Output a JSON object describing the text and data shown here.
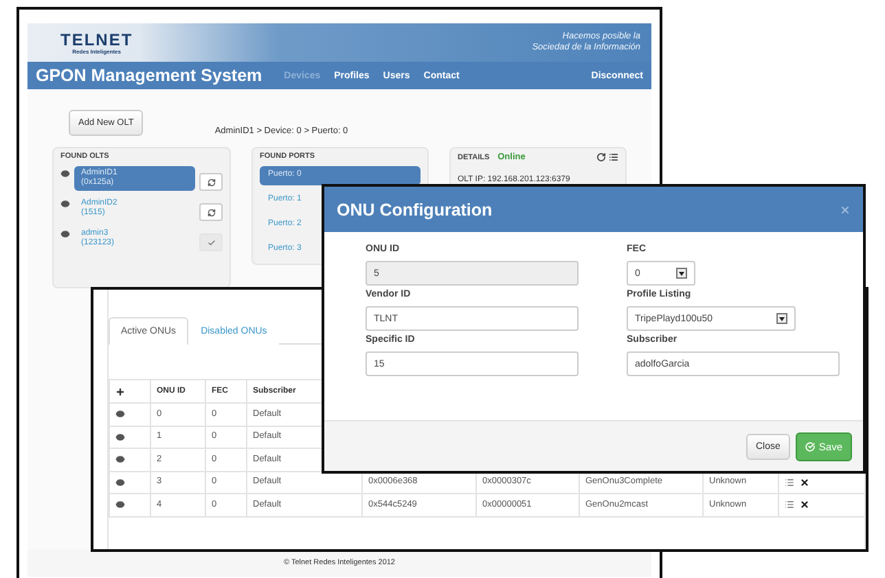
{
  "header": {
    "logo": "TELNET",
    "logo_tagline": "Redes Inteligentes",
    "slogan": [
      "Hacemos posible la",
      "Sociedad de la Información"
    ]
  },
  "navbar": {
    "title": "GPON Management System",
    "items": [
      {
        "label": "Devices",
        "selected": true
      },
      {
        "label": "Profiles",
        "selected": false
      },
      {
        "label": "Users",
        "selected": false
      },
      {
        "label": "Contact",
        "selected": false
      }
    ],
    "disconnect": "Disconnect"
  },
  "add_button": "Add New OLT",
  "breadcrumb": "AdminID1 > Device: 0 > Puerto: 0",
  "found_olts": {
    "title": "FOUND OLTS",
    "items": [
      {
        "name": "AdminID1",
        "id": "(0x125a)",
        "selected": true,
        "kind": "refresh"
      },
      {
        "name": "AdminID2",
        "id": "(1515)",
        "selected": false,
        "kind": "refresh"
      },
      {
        "name": "admin3",
        "id": "(123123)",
        "selected": false,
        "kind": "check"
      }
    ]
  },
  "found_ports": {
    "title": "FOUND PORTS",
    "items": [
      {
        "label": "Puerto: 0",
        "selected": true
      },
      {
        "label": "Puerto: 1",
        "selected": false
      },
      {
        "label": "Puerto: 2",
        "selected": false
      },
      {
        "label": "Puerto: 3",
        "selected": false
      }
    ]
  },
  "details": {
    "title": "DETAILS",
    "status": "Online",
    "olt_ip": "OLT IP: 192.168.201.123:6379"
  },
  "footer": "© Telnet Redes Inteligentes 2012",
  "onu_window": {
    "tabs": [
      {
        "label": "Active ONUs",
        "selected": true
      },
      {
        "label": "Disabled ONUs",
        "selected": false
      }
    ],
    "columns": [
      "ONU ID",
      "FEC",
      "Subscriber"
    ],
    "rows": [
      {
        "cells": [
          "0",
          "0",
          "Default"
        ]
      },
      {
        "cells": [
          "1",
          "0",
          "Default"
        ]
      },
      {
        "cells": [
          "2",
          "0",
          "Default"
        ]
      },
      {
        "cells": [
          "3",
          "0",
          "Default",
          "0x0006e368",
          "0x0000307c",
          "GenOnu3Complete",
          "Unknown"
        ]
      },
      {
        "cells": [
          "4",
          "0",
          "Default",
          "0x544c5249",
          "0x00000051",
          "GenOnu2mcast",
          "Unknown"
        ]
      }
    ]
  },
  "dialog": {
    "title": "ONU Configuration",
    "fields": [
      {
        "label": "ONU ID",
        "value": "5",
        "kind": "input",
        "disabled": true
      },
      {
        "label": "FEC",
        "value": "0",
        "kind": "select-short",
        "disabled": false
      },
      {
        "label": "Vendor ID",
        "value": "TLNT",
        "kind": "input",
        "disabled": false
      },
      {
        "label": "Profile Listing",
        "value": "TripePlayd100u50",
        "kind": "select",
        "disabled": false
      },
      {
        "label": "Specific ID",
        "value": "15",
        "kind": "input",
        "disabled": false
      },
      {
        "label": "Subscriber",
        "value": "adolfoGarcia",
        "kind": "input",
        "disabled": false
      }
    ],
    "buttons": {
      "close": "Close",
      "save": "Save"
    }
  }
}
